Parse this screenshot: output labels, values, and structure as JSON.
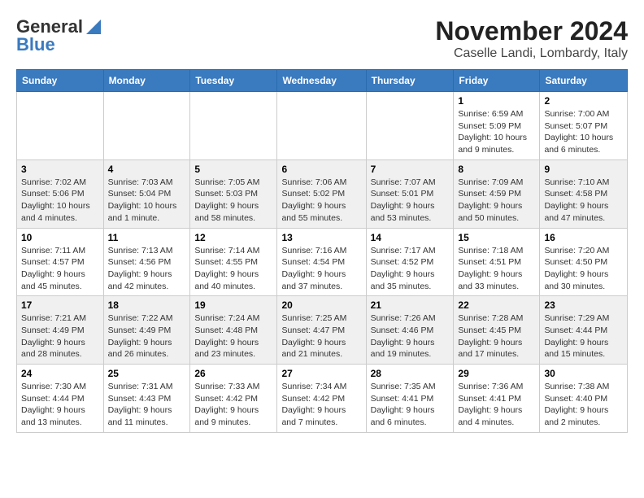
{
  "logo": {
    "general": "General",
    "blue": "Blue"
  },
  "title": "November 2024",
  "subtitle": "Caselle Landi, Lombardy, Italy",
  "weekdays": [
    "Sunday",
    "Monday",
    "Tuesday",
    "Wednesday",
    "Thursday",
    "Friday",
    "Saturday"
  ],
  "weeks": [
    [
      {
        "day": "",
        "info": ""
      },
      {
        "day": "",
        "info": ""
      },
      {
        "day": "",
        "info": ""
      },
      {
        "day": "",
        "info": ""
      },
      {
        "day": "",
        "info": ""
      },
      {
        "day": "1",
        "info": "Sunrise: 6:59 AM\nSunset: 5:09 PM\nDaylight: 10 hours and 9 minutes."
      },
      {
        "day": "2",
        "info": "Sunrise: 7:00 AM\nSunset: 5:07 PM\nDaylight: 10 hours and 6 minutes."
      }
    ],
    [
      {
        "day": "3",
        "info": "Sunrise: 7:02 AM\nSunset: 5:06 PM\nDaylight: 10 hours and 4 minutes."
      },
      {
        "day": "4",
        "info": "Sunrise: 7:03 AM\nSunset: 5:04 PM\nDaylight: 10 hours and 1 minute."
      },
      {
        "day": "5",
        "info": "Sunrise: 7:05 AM\nSunset: 5:03 PM\nDaylight: 9 hours and 58 minutes."
      },
      {
        "day": "6",
        "info": "Sunrise: 7:06 AM\nSunset: 5:02 PM\nDaylight: 9 hours and 55 minutes."
      },
      {
        "day": "7",
        "info": "Sunrise: 7:07 AM\nSunset: 5:01 PM\nDaylight: 9 hours and 53 minutes."
      },
      {
        "day": "8",
        "info": "Sunrise: 7:09 AM\nSunset: 4:59 PM\nDaylight: 9 hours and 50 minutes."
      },
      {
        "day": "9",
        "info": "Sunrise: 7:10 AM\nSunset: 4:58 PM\nDaylight: 9 hours and 47 minutes."
      }
    ],
    [
      {
        "day": "10",
        "info": "Sunrise: 7:11 AM\nSunset: 4:57 PM\nDaylight: 9 hours and 45 minutes."
      },
      {
        "day": "11",
        "info": "Sunrise: 7:13 AM\nSunset: 4:56 PM\nDaylight: 9 hours and 42 minutes."
      },
      {
        "day": "12",
        "info": "Sunrise: 7:14 AM\nSunset: 4:55 PM\nDaylight: 9 hours and 40 minutes."
      },
      {
        "day": "13",
        "info": "Sunrise: 7:16 AM\nSunset: 4:54 PM\nDaylight: 9 hours and 37 minutes."
      },
      {
        "day": "14",
        "info": "Sunrise: 7:17 AM\nSunset: 4:52 PM\nDaylight: 9 hours and 35 minutes."
      },
      {
        "day": "15",
        "info": "Sunrise: 7:18 AM\nSunset: 4:51 PM\nDaylight: 9 hours and 33 minutes."
      },
      {
        "day": "16",
        "info": "Sunrise: 7:20 AM\nSunset: 4:50 PM\nDaylight: 9 hours and 30 minutes."
      }
    ],
    [
      {
        "day": "17",
        "info": "Sunrise: 7:21 AM\nSunset: 4:49 PM\nDaylight: 9 hours and 28 minutes."
      },
      {
        "day": "18",
        "info": "Sunrise: 7:22 AM\nSunset: 4:49 PM\nDaylight: 9 hours and 26 minutes."
      },
      {
        "day": "19",
        "info": "Sunrise: 7:24 AM\nSunset: 4:48 PM\nDaylight: 9 hours and 23 minutes."
      },
      {
        "day": "20",
        "info": "Sunrise: 7:25 AM\nSunset: 4:47 PM\nDaylight: 9 hours and 21 minutes."
      },
      {
        "day": "21",
        "info": "Sunrise: 7:26 AM\nSunset: 4:46 PM\nDaylight: 9 hours and 19 minutes."
      },
      {
        "day": "22",
        "info": "Sunrise: 7:28 AM\nSunset: 4:45 PM\nDaylight: 9 hours and 17 minutes."
      },
      {
        "day": "23",
        "info": "Sunrise: 7:29 AM\nSunset: 4:44 PM\nDaylight: 9 hours and 15 minutes."
      }
    ],
    [
      {
        "day": "24",
        "info": "Sunrise: 7:30 AM\nSunset: 4:44 PM\nDaylight: 9 hours and 13 minutes."
      },
      {
        "day": "25",
        "info": "Sunrise: 7:31 AM\nSunset: 4:43 PM\nDaylight: 9 hours and 11 minutes."
      },
      {
        "day": "26",
        "info": "Sunrise: 7:33 AM\nSunset: 4:42 PM\nDaylight: 9 hours and 9 minutes."
      },
      {
        "day": "27",
        "info": "Sunrise: 7:34 AM\nSunset: 4:42 PM\nDaylight: 9 hours and 7 minutes."
      },
      {
        "day": "28",
        "info": "Sunrise: 7:35 AM\nSunset: 4:41 PM\nDaylight: 9 hours and 6 minutes."
      },
      {
        "day": "29",
        "info": "Sunrise: 7:36 AM\nSunset: 4:41 PM\nDaylight: 9 hours and 4 minutes."
      },
      {
        "day": "30",
        "info": "Sunrise: 7:38 AM\nSunset: 4:40 PM\nDaylight: 9 hours and 2 minutes."
      }
    ]
  ]
}
